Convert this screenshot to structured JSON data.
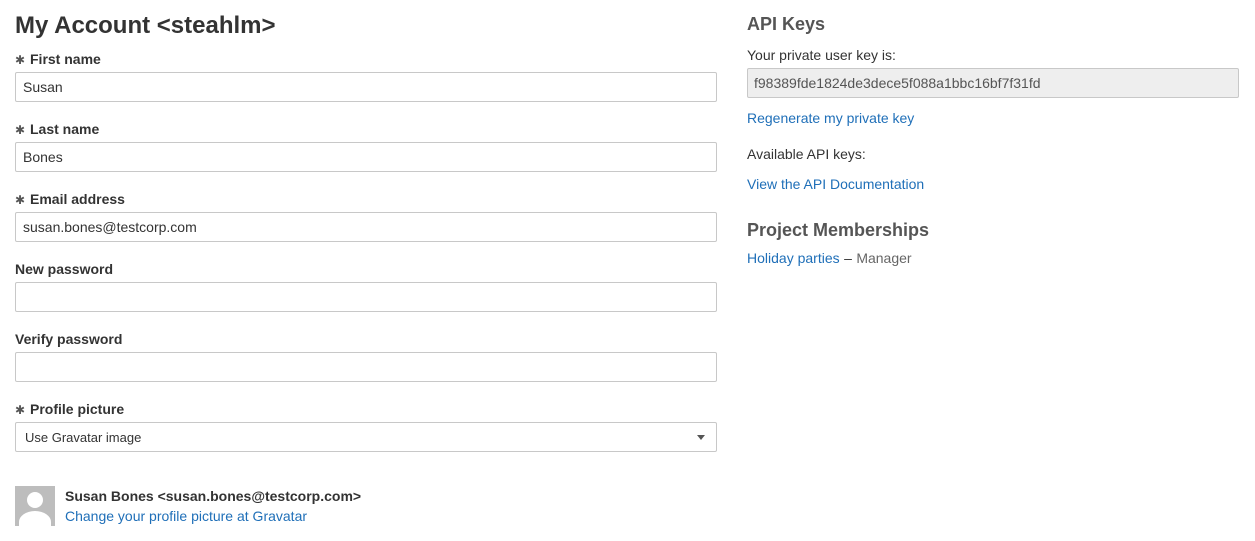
{
  "account": {
    "title": "My Account <steahlm>",
    "required_marker": "✱",
    "fields": {
      "first_name": {
        "label": "First name",
        "value": "Susan"
      },
      "last_name": {
        "label": "Last name",
        "value": "Bones"
      },
      "email": {
        "label": "Email address",
        "value": "susan.bones@testcorp.com"
      },
      "new_password": {
        "label": "New password",
        "value": ""
      },
      "verify_password": {
        "label": "Verify password",
        "value": ""
      },
      "profile_picture": {
        "label": "Profile picture",
        "selected": "Use Gravatar image"
      }
    },
    "profile": {
      "display": "Susan Bones <susan.bones@testcorp.com>",
      "change_link": "Change your profile picture at Gravatar"
    }
  },
  "api": {
    "heading": "API Keys",
    "private_key_label": "Your private user key is:",
    "private_key": "f98389fde1824de3dece5f088a1bbc16bf7f31fd",
    "regenerate_link": "Regenerate my private key",
    "available_label": "Available API keys:",
    "docs_link": "View the API Documentation"
  },
  "memberships": {
    "heading": "Project Memberships",
    "items": [
      {
        "project": "Holiday parties",
        "separator": "–",
        "role": "Manager"
      }
    ]
  },
  "colors": {
    "link": "#1f6fb8",
    "text": "#333333",
    "heading_gray": "#555555"
  }
}
